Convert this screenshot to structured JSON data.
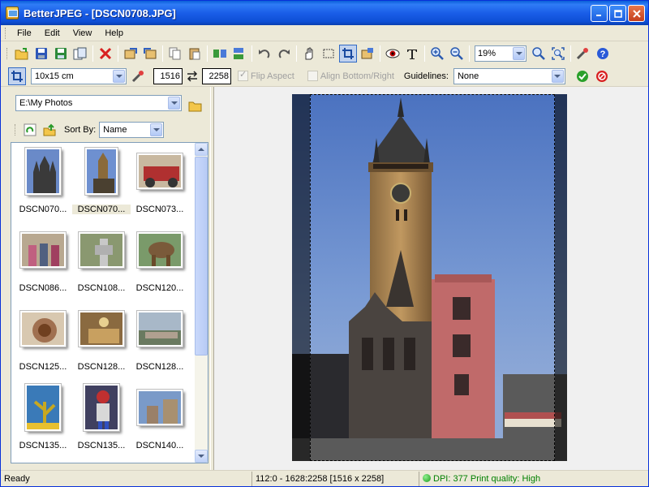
{
  "window": {
    "title": "BetterJPEG - [DSCN0708.JPG]"
  },
  "menu": [
    "File",
    "Edit",
    "View",
    "Help"
  ],
  "toolbar": {
    "zoom_value": "19%"
  },
  "croptoolbar": {
    "size_preset": "10x15 cm",
    "width_value": "1516",
    "height_value": "2258",
    "flip_aspect_label": "Flip Aspect",
    "align_label": "Align Bottom/Right",
    "guidelines_label": "Guidelines:",
    "guidelines_value": "None"
  },
  "browser": {
    "path": "E:\\My Photos",
    "sort_label": "Sort By:",
    "sort_value": "Name",
    "thumbnails": [
      {
        "name": "DSCN070..."
      },
      {
        "name": "DSCN070..."
      },
      {
        "name": "DSCN073..."
      },
      {
        "name": "DSCN086..."
      },
      {
        "name": "DSCN108..."
      },
      {
        "name": "DSCN120..."
      },
      {
        "name": "DSCN125..."
      },
      {
        "name": "DSCN128..."
      },
      {
        "name": "DSCN128..."
      },
      {
        "name": "DSCN135..."
      },
      {
        "name": "DSCN135..."
      },
      {
        "name": "DSCN140..."
      }
    ]
  },
  "status": {
    "state": "Ready",
    "crop_info": "112:0 - 1628:2258  [1516 x 2258]",
    "dpi_info": "DPI: 377  Print quality: High"
  },
  "colors": {
    "title_bar": "#0a5fd8",
    "status_good": "#008000",
    "accent": "#316ac5"
  }
}
